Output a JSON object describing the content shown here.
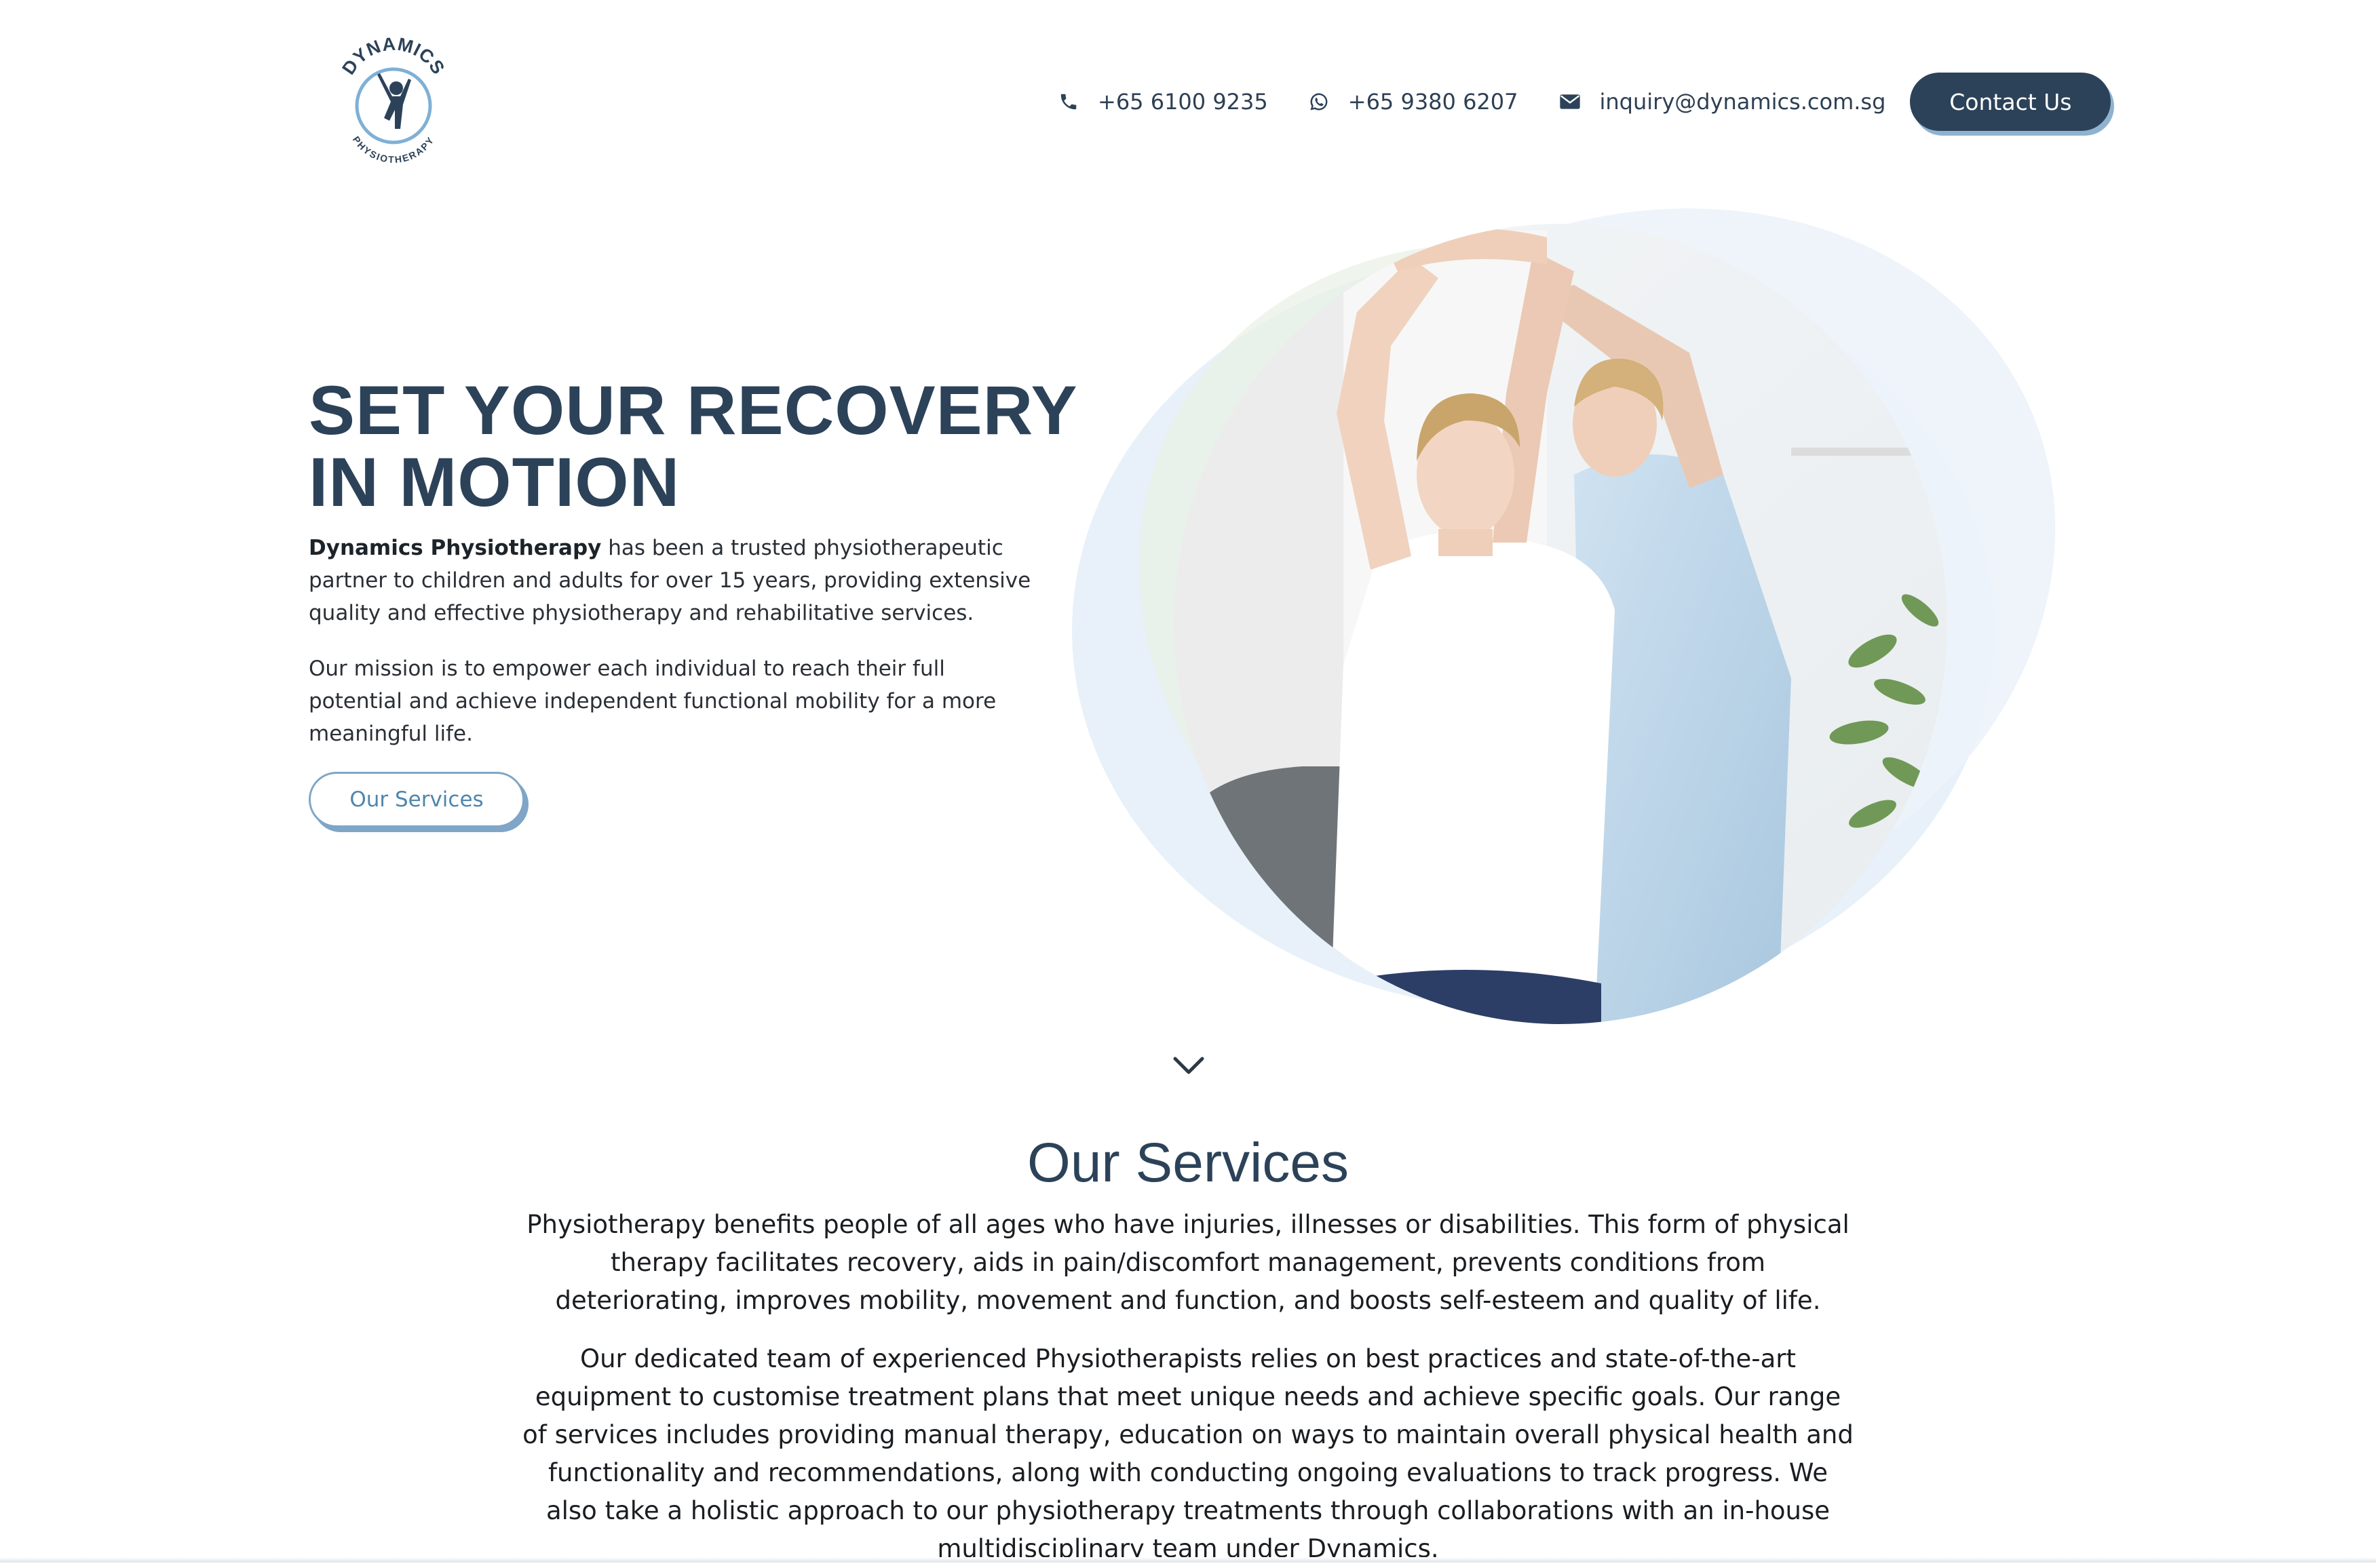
{
  "brand": {
    "logo_text_top": "DYNAMICS",
    "logo_text_bottom": "PHYSIOTHERAPY",
    "primary_color": "#2c4259",
    "accent_color": "#7fa6c6"
  },
  "header": {
    "phone": {
      "icon": "phone-icon",
      "text": "+65 6100 9235"
    },
    "whatsapp": {
      "icon": "whatsapp-icon",
      "text": "+65 9380 6207"
    },
    "email": {
      "icon": "envelope-icon",
      "text": "inquiry@dynamics.com.sg"
    },
    "contact_button": "Contact Us"
  },
  "hero": {
    "title_line1": "SET YOUR RECOVERY",
    "title_line2": "IN MOTION",
    "intro_bold": "Dynamics Physiotherapy",
    "intro_rest": " has been a trusted physiotherapeutic partner to children and adults for over 15 years, providing extensive quality and effective physiotherapy and rehabilitative services.",
    "mission": "Our mission is to empower each individual to reach their full potential and achieve independent functional mobility for a more meaningful life.",
    "services_button": "Our Services",
    "image_icon": "therapy-photo"
  },
  "services": {
    "title": "Our Services",
    "paragraph1": "Physiotherapy benefits people of all ages who have injuries, illnesses or disabilities. This form of physical therapy facilitates recovery, aids in pain/discomfort management, prevents conditions from deteriorating, improves mobility, movement and function, and boosts self-esteem and quality of life.",
    "paragraph2": "Our dedicated team of experienced Physiotherapists relies on best practices and state-of-the-art equipment to customise treatment plans that meet unique needs and achieve specific goals. Our range of services includes providing manual therapy, education on ways to maintain overall physical health and functionality and recommendations, along with conducting ongoing evaluations to track progress. We also take a holistic approach to our physiotherapy treatments through collaborations with an in-house multidisciplinary team under Dynamics."
  }
}
